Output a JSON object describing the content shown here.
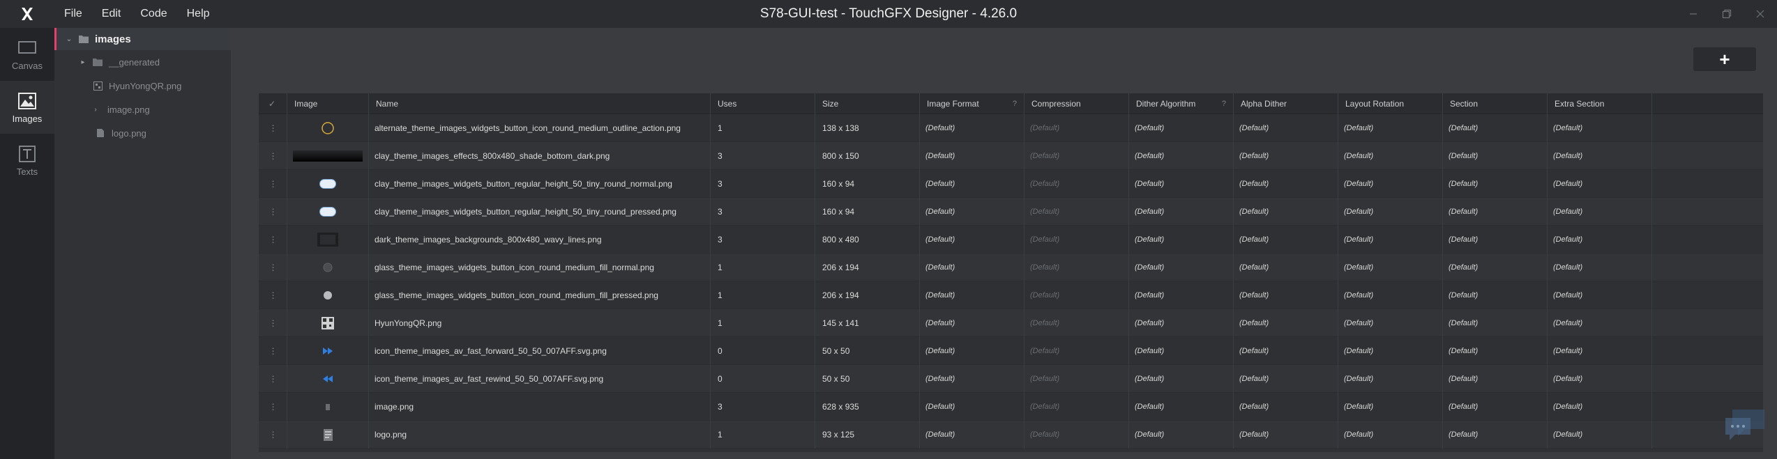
{
  "app": {
    "title": "S78-GUI-test - TouchGFX Designer - 4.26.0"
  },
  "menu": [
    "File",
    "Edit",
    "Code",
    "Help"
  ],
  "nav": [
    {
      "label": "Canvas",
      "icon": "canvas-icon",
      "active": false
    },
    {
      "label": "Images",
      "icon": "images-icon",
      "active": true
    },
    {
      "label": "Texts",
      "icon": "texts-icon",
      "active": false
    }
  ],
  "tree": {
    "root": "images",
    "children": [
      {
        "label": "__generated",
        "icon": "folder-icon",
        "expandable": true
      },
      {
        "label": "HyunYongQR.png",
        "icon": "qr-file-icon",
        "expandable": false
      },
      {
        "label": "image.png",
        "icon": "image-file-icon",
        "expandable": true
      },
      {
        "label": "logo.png",
        "icon": "file-icon",
        "expandable": false
      }
    ]
  },
  "add_button": "+",
  "table": {
    "headers": [
      "",
      "Image",
      "Name",
      "Uses",
      "Size",
      "Image Format",
      "Compression",
      "Dither Algorithm",
      "Alpha Dither",
      "Layout Rotation",
      "Section",
      "Extra Section"
    ],
    "header_help": [
      "Image Format",
      "Dither Algorithm"
    ],
    "default_label": "(Default)",
    "rows": [
      {
        "thumb": "circle-outline",
        "name": "alternate_theme_images_widgets_button_icon_round_medium_outline_action.png",
        "uses": "1",
        "size": "138 x 138"
      },
      {
        "thumb": "dark-bar",
        "name": "clay_theme_images_effects_800x480_shade_bottom_dark.png",
        "uses": "3",
        "size": "800 x 150"
      },
      {
        "thumb": "pill",
        "name": "clay_theme_images_widgets_button_regular_height_50_tiny_round_normal.png",
        "uses": "3",
        "size": "160 x 94"
      },
      {
        "thumb": "pill",
        "name": "clay_theme_images_widgets_button_regular_height_50_tiny_round_pressed.png",
        "uses": "3",
        "size": "160 x 94"
      },
      {
        "thumb": "dark-square",
        "name": "dark_theme_images_backgrounds_800x480_wavy_lines.png",
        "uses": "3",
        "size": "800 x 480"
      },
      {
        "thumb": "grey-dot",
        "name": "glass_theme_images_widgets_button_icon_round_medium_fill_normal.png",
        "uses": "1",
        "size": "206 x 194"
      },
      {
        "thumb": "light-dot",
        "name": "glass_theme_images_widgets_button_icon_round_medium_fill_pressed.png",
        "uses": "1",
        "size": "206 x 194"
      },
      {
        "thumb": "qr",
        "name": "HyunYongQR.png",
        "uses": "1",
        "size": "145 x 141"
      },
      {
        "thumb": "fast-forward",
        "name": "icon_theme_images_av_fast_forward_50_50_007AFF.svg.png",
        "uses": "0",
        "size": "50 x 50"
      },
      {
        "thumb": "fast-rewind",
        "name": "icon_theme_images_av_fast_rewind_50_50_007AFF.svg.png",
        "uses": "0",
        "size": "50 x 50"
      },
      {
        "thumb": "tiny",
        "name": "image.png",
        "uses": "3",
        "size": "628 x 935"
      },
      {
        "thumb": "logo",
        "name": "logo.png",
        "uses": "1",
        "size": "93 x 125"
      }
    ]
  },
  "colors": {
    "accent": "#e3406d",
    "icon_blue": "#2f7fe0"
  }
}
